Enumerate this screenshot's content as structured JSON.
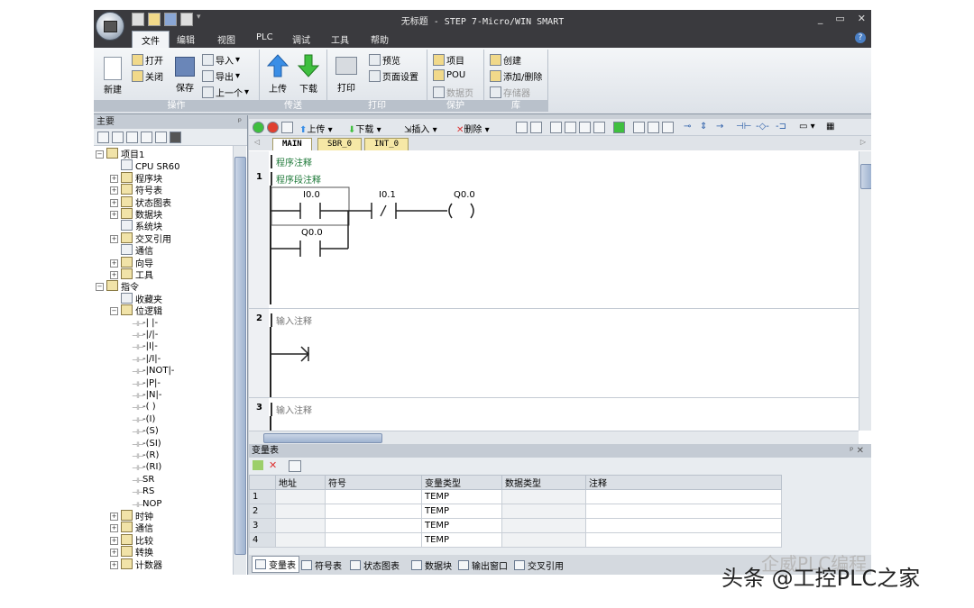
{
  "window": {
    "title": "无标题 - STEP 7-Micro/WIN SMART",
    "controls": [
      "_",
      "▭",
      "✕"
    ]
  },
  "menu": {
    "tabs": [
      "文件",
      "编辑",
      "视图",
      "PLC",
      "调试",
      "工具",
      "帮助"
    ],
    "active": "文件",
    "help": "?"
  },
  "ribbon": {
    "groups": [
      "操作",
      "传送",
      "打印",
      "保护",
      "库"
    ],
    "new": "新建",
    "open": "打开",
    "close": "关闭",
    "save": "保存",
    "import": "导入",
    "export": "导出",
    "prev": "上一个",
    "upload": "上传",
    "download": "下载",
    "print": "打印",
    "preview": "预览",
    "page_setup": "页面设置",
    "project": "项目",
    "pou": "POU",
    "datapage": "数据页",
    "create": "创建",
    "add_delete": "添加/删除",
    "memory": "存储器"
  },
  "left_panel": {
    "title": "主要",
    "pin": "ᵖ",
    "tree": [
      {
        "label": "项目1",
        "level": 0,
        "exp": "−"
      },
      {
        "label": "CPU SR60",
        "level": 1,
        "exp": ""
      },
      {
        "label": "程序块",
        "level": 1,
        "exp": "+"
      },
      {
        "label": "符号表",
        "level": 1,
        "exp": "+"
      },
      {
        "label": "状态图表",
        "level": 1,
        "exp": "+"
      },
      {
        "label": "数据块",
        "level": 1,
        "exp": "+"
      },
      {
        "label": "系统块",
        "level": 1,
        "exp": ""
      },
      {
        "label": "交叉引用",
        "level": 1,
        "exp": "+"
      },
      {
        "label": "通信",
        "level": 1,
        "exp": ""
      },
      {
        "label": "向导",
        "level": 1,
        "exp": "+"
      },
      {
        "label": "工具",
        "level": 1,
        "exp": "+"
      },
      {
        "label": "指令",
        "level": 0,
        "exp": "−"
      },
      {
        "label": "收藏夹",
        "level": 1,
        "exp": ""
      },
      {
        "label": "位逻辑",
        "level": 1,
        "exp": "−"
      },
      {
        "label": "-| |-",
        "level": 2,
        "exp": ""
      },
      {
        "label": "-|/|-",
        "level": 2,
        "exp": ""
      },
      {
        "label": "-|I|-",
        "level": 2,
        "exp": ""
      },
      {
        "label": "-|/I|-",
        "level": 2,
        "exp": ""
      },
      {
        "label": "-|NOT|-",
        "level": 2,
        "exp": ""
      },
      {
        "label": "-|P|-",
        "level": 2,
        "exp": ""
      },
      {
        "label": "-|N|-",
        "level": 2,
        "exp": ""
      },
      {
        "label": "-( )",
        "level": 2,
        "exp": ""
      },
      {
        "label": "-(I)",
        "level": 2,
        "exp": ""
      },
      {
        "label": "-(S)",
        "level": 2,
        "exp": ""
      },
      {
        "label": "-(SI)",
        "level": 2,
        "exp": ""
      },
      {
        "label": "-(R)",
        "level": 2,
        "exp": ""
      },
      {
        "label": "-(RI)",
        "level": 2,
        "exp": ""
      },
      {
        "label": "SR",
        "level": 2,
        "exp": ""
      },
      {
        "label": "RS",
        "level": 2,
        "exp": ""
      },
      {
        "label": "NOP",
        "level": 2,
        "exp": ""
      },
      {
        "label": "时钟",
        "level": 1,
        "exp": "+"
      },
      {
        "label": "通信",
        "level": 1,
        "exp": "+"
      },
      {
        "label": "比较",
        "level": 1,
        "exp": "+"
      },
      {
        "label": "转换",
        "level": 1,
        "exp": "+"
      },
      {
        "label": "计数器",
        "level": 1,
        "exp": "+"
      }
    ]
  },
  "editor": {
    "toolbar": {
      "upload": "上传",
      "download": "下载",
      "insert": "插入",
      "delete": "删除"
    },
    "tabs": [
      "MAIN",
      "SBR_0",
      "INT_0"
    ],
    "program_comment": "程序注释",
    "networks": [
      {
        "num": "1",
        "comment": "程序段注释"
      },
      {
        "num": "2",
        "comment": "输入注释"
      },
      {
        "num": "3",
        "comment": "输入注释"
      }
    ],
    "ladder": {
      "c1": "I0.0",
      "c2": "I0.1",
      "coil": "Q0.0",
      "c3": "Q0.0"
    }
  },
  "var_table": {
    "title": "变量表",
    "pin": "ᵖ ✕",
    "headers": [
      "",
      "地址",
      "符号",
      "变量类型",
      "数据类型",
      "注释"
    ],
    "rows": [
      [
        "1",
        "",
        "",
        "TEMP",
        "",
        ""
      ],
      [
        "2",
        "",
        "",
        "TEMP",
        "",
        ""
      ],
      [
        "3",
        "",
        "",
        "TEMP",
        "",
        ""
      ],
      [
        "4",
        "",
        "",
        "TEMP",
        "",
        ""
      ]
    ]
  },
  "bottom_tabs": [
    "变量表",
    "符号表",
    "状态图表",
    "数据块",
    "输出窗口",
    "交叉引用"
  ],
  "watermark": {
    "caption": "头条 @工控PLC之家",
    "logo": "企威PLC编程"
  }
}
